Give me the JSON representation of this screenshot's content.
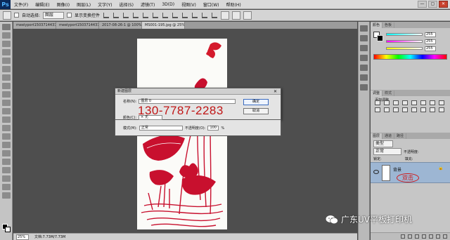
{
  "app": {
    "logo": "Ps",
    "menus": [
      "文件(F)",
      "编辑(E)",
      "图像(I)",
      "图层(L)",
      "文字(Y)",
      "选择(S)",
      "滤镜(T)",
      "3D(D)",
      "视图(V)",
      "窗口(W)",
      "帮助(H)"
    ],
    "window_controls": [
      "—",
      "▢",
      "✕"
    ]
  },
  "options_bar": {
    "auto_select_label": "自动选择:",
    "auto_select_value": "图层",
    "show_transform_label": "显示变换控件"
  },
  "tabs": [
    "meeiyport1503714437422.jpg @ 12.7%(C...",
    "meeiyport1503714437817.jpg @ 8.33%(R...",
    "2017-08-26-1 @ 100% (图层 1, CMYK...",
    "MS001-195.jpg @ 25%(RGB/8#)..."
  ],
  "status_bar": {
    "zoom": "25%",
    "doc_info": "文档:7.73M/7.73M"
  },
  "color_panel": {
    "tabs": [
      "颜色",
      "色板"
    ],
    "values": [
      "255",
      "255",
      "255"
    ],
    "colors": {
      "fg": "#ffffff",
      "r_track": "#d05050",
      "g_track": "#50c050",
      "b_track": "#c050c0"
    }
  },
  "adjust_panel": {
    "tabs": [
      "调整",
      "样式"
    ],
    "label": "添加调整"
  },
  "layers_panel": {
    "tabs": [
      "图层",
      "通道",
      "路径"
    ],
    "kind_label": "类型",
    "blend_mode": "正常",
    "opacity_label": "不透明度:",
    "lock_label": "锁定:",
    "fill_label": "填充:",
    "layer_name": "背景",
    "signature": "双击"
  },
  "dialog": {
    "title": "新建图层",
    "name_label": "名称(N):",
    "name_value": "图层 0",
    "color_label": "颜色(C):",
    "color_value": "× 无",
    "mode_label": "模式(M):",
    "mode_value": "正常",
    "opacity_label": "不透明度(O):",
    "opacity_value": "100",
    "percent": "%",
    "ok_label": "确定",
    "cancel_label": "取消"
  },
  "overlay": {
    "phone": "130-7787-2283",
    "watermark": "广东UV平板打印机"
  }
}
